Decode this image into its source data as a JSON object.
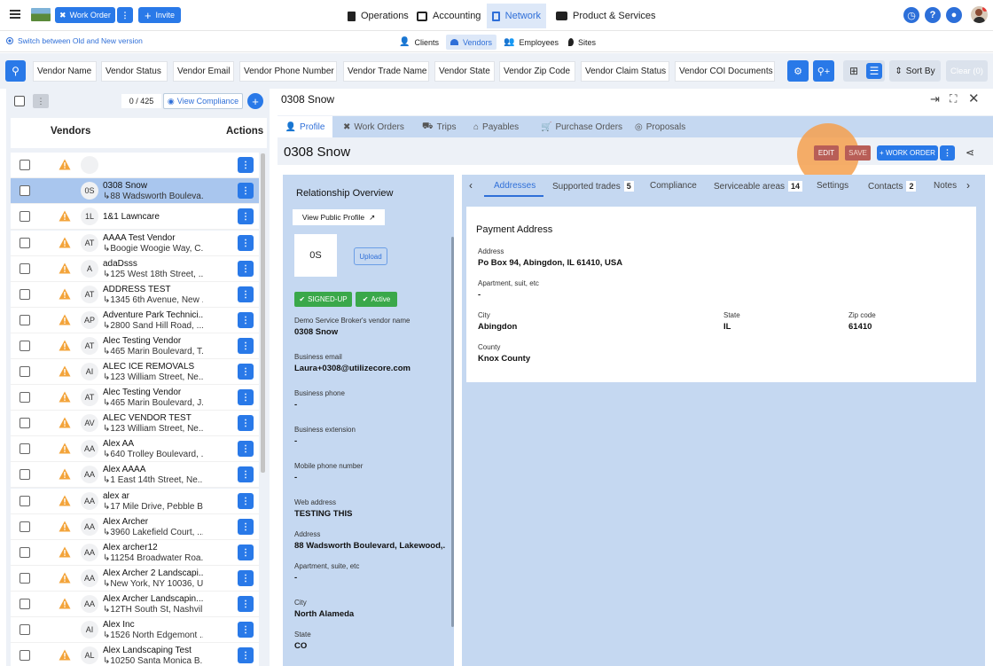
{
  "topbar": {
    "work_order_label": "Work Order",
    "invite_label": "Invite",
    "tabs": [
      {
        "label": "Operations",
        "icon": "clipboard-icon"
      },
      {
        "label": "Accounting",
        "icon": "ledger-icon"
      },
      {
        "label": "Network",
        "icon": "network-icon"
      },
      {
        "label": "Product & Services",
        "icon": "briefcase-icon"
      }
    ],
    "help_icon_text": "?"
  },
  "subbar": {
    "switch_label": "Switch between Old and New version",
    "tabs": [
      {
        "label": "Clients"
      },
      {
        "label": "Vendors"
      },
      {
        "label": "Employees"
      },
      {
        "label": "Sites"
      }
    ]
  },
  "filters": {
    "chips": [
      "Vendor Name",
      "Vendor Status",
      "Vendor Email",
      "Vendor Phone Number",
      "Vendor Trade Name",
      "Vendor State",
      "Vendor Zip Code",
      "Vendor Claim Status",
      "Vendor COI Documents"
    ],
    "sort_label": "Sort By",
    "clear_label": "Clear (0)"
  },
  "left": {
    "count": "0 / 425",
    "view_compliance_label": "View Compliance",
    "header_vendors": "Vendors",
    "header_actions": "Actions",
    "rows": [
      {
        "initials": "",
        "name": "",
        "addr": "",
        "warn": true
      },
      {
        "initials": "0S",
        "name": "0308 Snow",
        "addr": "↳88 Wadsworth Bouleva...",
        "warn": false,
        "selected": true
      },
      {
        "initials": "1L",
        "name": "1&1 Lawncare",
        "addr": "",
        "warn": true
      },
      {
        "initials": "AT",
        "name": "AAAA Test Vendor",
        "addr": "↳Boogie Woogie Way, C...",
        "warn": true
      },
      {
        "initials": "A",
        "name": "adaDsss",
        "addr": "↳125 West 18th Street, ...",
        "warn": true
      },
      {
        "initials": "AT",
        "name": "ADDRESS TEST",
        "addr": "↳1345 6th Avenue, New ...",
        "warn": true
      },
      {
        "initials": "AP",
        "name": "Adventure Park Technici...",
        "addr": "↳2800 Sand Hill Road, ...",
        "warn": true
      },
      {
        "initials": "AT",
        "name": "Alec Testing Vendor",
        "addr": "↳465 Marin Boulevard, T...",
        "warn": true
      },
      {
        "initials": "AI",
        "name": "ALEC ICE REMOVALS",
        "addr": "↳123 William Street, Ne...",
        "warn": true
      },
      {
        "initials": "AT",
        "name": "Alec Testing Vendor",
        "addr": "↳465 Marin Boulevard, J...",
        "warn": true
      },
      {
        "initials": "AV",
        "name": "ALEC VENDOR TEST",
        "addr": "↳123 William Street, Ne...",
        "warn": true
      },
      {
        "initials": "AA",
        "name": "Alex AA",
        "addr": "↳640 Trolley Boulevard, ...",
        "warn": true
      },
      {
        "initials": "AA",
        "name": "Alex AAAA",
        "addr": "↳1 East 14th Street, Ne...",
        "warn": true
      },
      {
        "initials": "AA",
        "name": "alex ar",
        "addr": "↳17 Mile Drive, Pebble B...",
        "warn": true
      },
      {
        "initials": "AA",
        "name": "Alex Archer",
        "addr": "↳3960 Lakefield Court, ...",
        "warn": true
      },
      {
        "initials": "AA",
        "name": "Alex archer12",
        "addr": "↳11254 Broadwater Roa...",
        "warn": true
      },
      {
        "initials": "AA",
        "name": "Alex Archer 2 Landscapi...",
        "addr": "↳New York, NY 10036, U...",
        "warn": true
      },
      {
        "initials": "AA",
        "name": "Alex Archer Landscapin...",
        "addr": "↳12TH South St, Nashvil...",
        "warn": true
      },
      {
        "initials": "AI",
        "name": "Alex Inc",
        "addr": "↳1526 North Edgemont ...",
        "warn": false
      },
      {
        "initials": "AL",
        "name": "Alex Landscaping Test",
        "addr": "↳10250 Santa Monica B...",
        "warn": true
      }
    ]
  },
  "right": {
    "header_title": "0308 Snow",
    "vendor_title": "0308 Snow",
    "tabs": [
      "Profile",
      "Work Orders",
      "Trips",
      "Payables",
      "Purchase Orders",
      "Proposals"
    ],
    "edit_label": "EDIT",
    "save_label": "SAVE",
    "work_order_label": "+ WORK ORDER",
    "relationship": {
      "title": "Relationship Overview",
      "view_public_label": "View Public Profile",
      "logo_initials": "0S",
      "upload_label": "Upload",
      "badge_signed": "SIGNED-UP",
      "badge_active": "Active",
      "fields": [
        {
          "label": "Demo Service Broker's vendor name",
          "value": "0308 Snow"
        },
        {
          "label": "Business email",
          "value": "Laura+0308@utilizecore.com"
        },
        {
          "label": "Business phone",
          "value": "-"
        },
        {
          "label": "Business extension",
          "value": "-"
        },
        {
          "label": "Mobile phone number",
          "value": "-"
        },
        {
          "label": "Web address",
          "value": "TESTING THIS"
        },
        {
          "label": "Address",
          "value": "88 Wadsworth Boulevard, Lakewood,..."
        },
        {
          "label": "Apartment, suite, etc",
          "value": "-"
        },
        {
          "label": "City",
          "value": "North Alameda"
        },
        {
          "label": "State",
          "value": "CO"
        }
      ]
    },
    "detail_tabs": [
      {
        "label": "Addresses",
        "count": ""
      },
      {
        "label": "Supported trades",
        "count": "5"
      },
      {
        "label": "Compliance",
        "count": ""
      },
      {
        "label": "Serviceable areas",
        "count": "14"
      },
      {
        "label": "Settings",
        "count": ""
      },
      {
        "label": "Contacts",
        "count": "2"
      },
      {
        "label": "Notes",
        "count": ""
      }
    ],
    "payment": {
      "title": "Payment Address",
      "address_label": "Address",
      "address_value": "Po Box 94, Abingdon, IL 61410, USA",
      "apt_label": "Apartment, suit, etc",
      "apt_value": "-",
      "city_label": "City",
      "city_value": "Abingdon",
      "state_label": "State",
      "state_value": "IL",
      "zip_label": "Zip code",
      "zip_value": "61410",
      "county_label": "County",
      "county_value": "Knox County"
    }
  },
  "colors": {
    "accent": "#2979e8",
    "highlight": "#f5a04e",
    "panel": "#c5d8f1"
  }
}
